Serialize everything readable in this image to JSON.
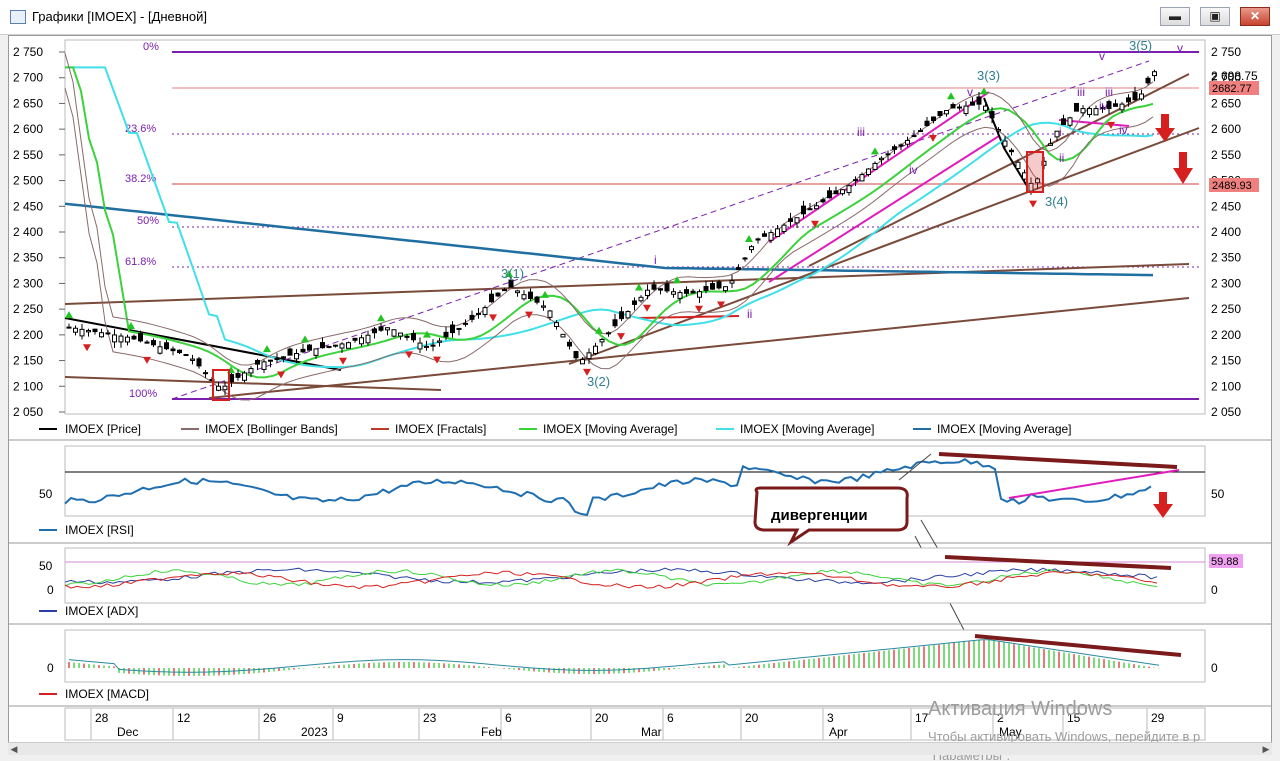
{
  "window": {
    "title": "Графики [IMOEX] - [Дневной]",
    "controls": {
      "minimize": "▬",
      "maximize": "▣",
      "close": "✕"
    }
  },
  "price_panel": {
    "fib_labels": [
      "0%",
      "23.6%",
      "38.2%",
      "50%",
      "61.8%",
      "100%"
    ],
    "y_ticks": [
      "2 750",
      "2 700",
      "2 650",
      "2 600",
      "2 550",
      "2 500",
      "2 450",
      "2 400",
      "2 350",
      "2 300",
      "2 250",
      "2 200",
      "2 150",
      "2 100",
      "2 050"
    ],
    "last_value_top": "2 698.75",
    "price_flags": [
      "2682.77",
      "2489.93"
    ],
    "wave_labels": [
      "3(1)",
      "3(2)",
      "3(3)",
      "3(4)",
      "3(5)",
      "i",
      "ii",
      "iii",
      "iv",
      "v",
      "i",
      "ii",
      "iii",
      "iv",
      "iii",
      "iv",
      "v",
      "v"
    ],
    "legend": [
      {
        "label": "IMOEX [Price]",
        "color": "#000000"
      },
      {
        "label": "IMOEX [Bollinger Bands]",
        "color": "#8a6a6a"
      },
      {
        "label": "IMOEX [Fractals]",
        "color": "#c0392b"
      },
      {
        "label": "IMOEX [Moving Average]",
        "color": "#3cd23c"
      },
      {
        "label": "IMOEX [Moving Average]",
        "color": "#40e0e8"
      },
      {
        "label": "IMOEX [Moving Average]",
        "color": "#1f6fa0"
      }
    ]
  },
  "rsi_panel": {
    "legend": "IMOEX [RSI]",
    "y_tick": "50",
    "y_tick_right": "50",
    "annotation": "дивергенции"
  },
  "adx_panel": {
    "legend": "IMOEX [ADX]",
    "y_ticks": [
      "50",
      "0"
    ],
    "y_tick_right": "0",
    "flag": "59.88"
  },
  "macd_panel": {
    "legend": "IMOEX [MACD]",
    "y_tick": "0",
    "y_tick_right": "0"
  },
  "time_axis": {
    "days": [
      "28",
      "12",
      "26",
      "9",
      "23",
      "6",
      "20",
      "6",
      "20",
      "3",
      "17",
      "2",
      "15",
      "29"
    ],
    "months": [
      "Dec",
      "2023",
      "Feb",
      "Mar",
      "Apr",
      "May"
    ]
  },
  "watermark": {
    "line1": "Активация Windows",
    "line2": "Чтобы активировать Windows, перейдите в р",
    "line3": "\"Параметры\"."
  },
  "colors": {
    "price": "#000000",
    "fractal_down": "#d62020",
    "fractal_up": "#22c422",
    "fib": "#7a1fb0",
    "channel": "#e01cbc",
    "trend": "#7a4a3a",
    "divergence": "#7a1a1a"
  }
}
